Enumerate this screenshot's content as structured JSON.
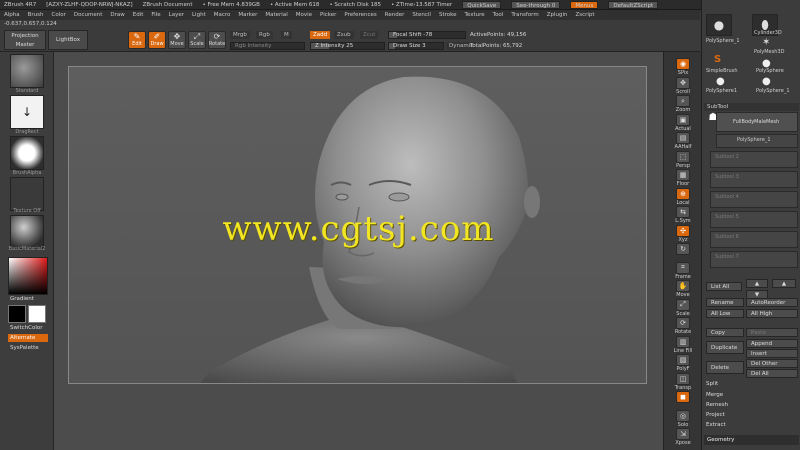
{
  "titlebar": {
    "app": "ZBrush 4R7",
    "coords": "[AZXY-ZLHF-QDOP-NRWJ-NKAZ]",
    "document": "ZBrush Document",
    "free_mem": "• Free Mem 4.839GB",
    "active_mem": "• Active Mem 618",
    "scratch": "• Scratch Disk 185",
    "ztime": "• ZTime›13.587 Timer",
    "quicksave": "QuickSave",
    "seethrough": "See-through  0",
    "menus": "Menus",
    "script": "DefaultZScript"
  },
  "menubar": [
    "Alpha",
    "Brush",
    "Color",
    "Document",
    "Draw",
    "Edit",
    "File",
    "Layer",
    "Light",
    "Macro",
    "Marker",
    "Material",
    "Movie",
    "Picker",
    "Preferences",
    "Render",
    "Stencil",
    "Stroke",
    "Texture",
    "Tool",
    "Transform",
    "Zplugin",
    "Zscript"
  ],
  "coord_readout": "-0.637,0.657,0.124",
  "toolbar": {
    "projection_master": "Projection Master",
    "lightbox": "LightBox",
    "edit": "Edit",
    "draw": "Draw",
    "move": "Move",
    "scale": "Scale",
    "rotate": "Rotate",
    "mrgb": "Mrgb",
    "rgb": "Rgb",
    "m": "M",
    "rgb_intensity": "Rgb Intensity",
    "zadd": "Zadd",
    "zsub": "Zsub",
    "zcut": "Zcut",
    "z_intensity": "Z Intensity 25",
    "focal_shift": "Focal Shift -78",
    "draw_size": "Draw Size 3",
    "dynamic": "Dynamic",
    "active_points": "ActivePoints: 49,156",
    "total_points": "TotalPoints: 65,792"
  },
  "lefttray": {
    "brush_label": "Standard",
    "stroke_label": "DragRect",
    "alpha_label": "BrushAlpha",
    "texture_label": "Texture Off",
    "material_label": "BasicMaterial2",
    "gradient": "Gradient",
    "switchcolor": "SwitchColor",
    "alternate": "Alternate",
    "syspalette": "SysPalette"
  },
  "watermark": "www.cgtsj.com",
  "rightshelf": [
    {
      "label": "SPix",
      "icon": "◉",
      "active": true
    },
    {
      "label": "Scroll",
      "icon": "✥",
      "active": false
    },
    {
      "label": "Zoom",
      "icon": "⌕",
      "active": false
    },
    {
      "label": "Actual",
      "icon": "▣",
      "active": false
    },
    {
      "label": "AAHalf",
      "icon": "▤",
      "active": false
    },
    {
      "label": "Persp",
      "icon": "⬚",
      "active": false
    },
    {
      "label": "Floor",
      "icon": "▦",
      "active": false
    },
    {
      "label": "Local",
      "icon": "⊕",
      "active": true
    },
    {
      "label": "L.Sym",
      "icon": "⇆",
      "active": false
    },
    {
      "label": "Xyz",
      "icon": "✣",
      "active": true
    },
    {
      "label": "",
      "icon": "↻",
      "active": false
    },
    {
      "label": "Frame",
      "icon": "⌗",
      "active": false
    },
    {
      "label": "Move",
      "icon": "✋",
      "active": false
    },
    {
      "label": "Scale",
      "icon": "⤢",
      "active": false
    },
    {
      "label": "Rotate",
      "icon": "⟳",
      "active": false
    },
    {
      "label": "Line Fill",
      "icon": "▥",
      "active": false
    },
    {
      "label": "PolyF",
      "icon": "▧",
      "active": false
    },
    {
      "label": "Transp",
      "icon": "◫",
      "active": false
    },
    {
      "label": "",
      "icon": "◼",
      "active": true
    },
    {
      "label": "Solo",
      "icon": "◎",
      "active": false
    },
    {
      "label": "Xpose",
      "icon": "⇲",
      "active": false
    }
  ],
  "rightpanel": {
    "tools": [
      {
        "name": "PolySphere_1",
        "icon": "●"
      },
      {
        "name": "Cylinder3D",
        "icon": "⬮"
      },
      {
        "name": "PolyMesh3D",
        "icon": "✶"
      },
      {
        "name": "SimpleBrush",
        "icon": "S"
      },
      {
        "name": "PolySphere",
        "icon": "●"
      },
      {
        "name": "PolySphere1",
        "icon": "●"
      },
      {
        "name": "PolySphere_1",
        "icon": "●"
      }
    ],
    "subtool_header": "SubTool",
    "subtool_active_name": "FullBodyMaleMesh",
    "subtool_active_sub": "PolySphere_1",
    "subtool_slots": [
      "Subtool 2",
      "Subtool 3",
      "Subtool 4",
      "Subtool 5",
      "Subtool 6",
      "Subtool 7"
    ],
    "list_all": "List  All",
    "rename": "Rename",
    "autoreorder": "AutoReorder",
    "all_low": "All Low",
    "all_high": "All High",
    "copy": "Copy",
    "paste": "Paste",
    "duplicate": "Duplicate",
    "append": "Append",
    "insert": "Insert",
    "delete": "Delete",
    "del_other": "Del Other",
    "del_all": "Del All",
    "split": "Split",
    "merge": "Merge",
    "remesh": "Remesh",
    "project": "Project",
    "extract": "Extract",
    "geometry": "Geometry"
  },
  "colors": {
    "accent": "#d9680f",
    "watermark": "#f2e623",
    "canvas": "#5a5a5a"
  }
}
